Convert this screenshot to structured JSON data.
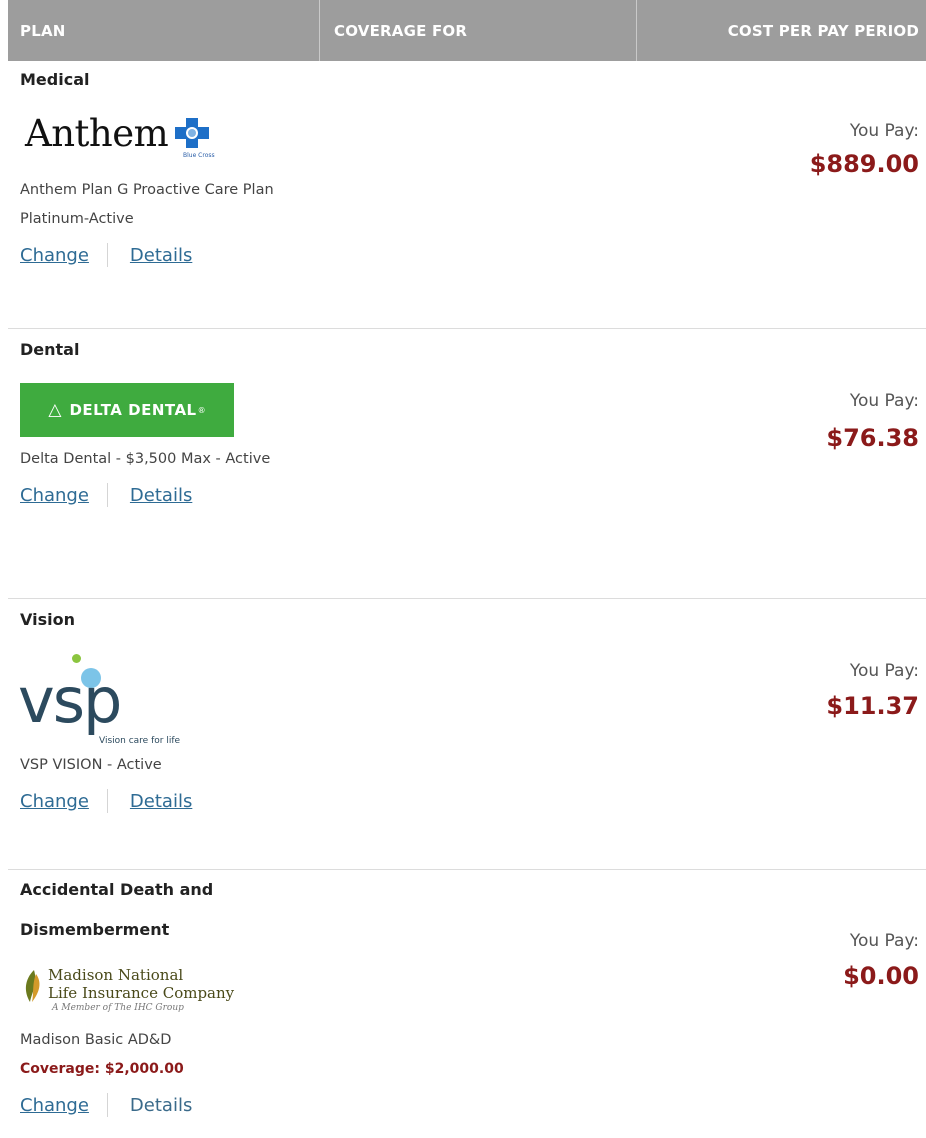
{
  "header": {
    "col_plan": "PLAN",
    "col_coverage": "COVERAGE FOR",
    "col_cost": "COST PER PAY PERIOD"
  },
  "pay_label": "You Pay:",
  "links": {
    "change": "Change",
    "details": "Details"
  },
  "plans": [
    {
      "category": "Medical",
      "logo": {
        "name": "Anthem",
        "sub": "Blue Cross",
        "icon": "anthem-cross-shield"
      },
      "description_lines": [
        "Anthem Plan G Proactive Care Plan",
        "Platinum-Active"
      ],
      "cost": "$889.00"
    },
    {
      "category": "Dental",
      "logo": {
        "name": "DELTA DENTAL",
        "mark": "®",
        "color": "#3fab3f"
      },
      "description_lines": [
        "Delta Dental - $3,500 Max - Active"
      ],
      "cost": "$76.38"
    },
    {
      "category": "Vision",
      "logo": {
        "name": "vsp",
        "tagline": "Vision care for life"
      },
      "description_lines": [
        "VSP VISION - Active"
      ],
      "cost": "$11.37"
    },
    {
      "category_lines": [
        "Accidental Death and",
        "Dismemberment"
      ],
      "logo": {
        "line1": "Madison National",
        "line2": "Life Insurance Company",
        "line3": "A Member of The IHC Group"
      },
      "description_lines": [
        "Madison Basic AD&D"
      ],
      "coverage": "Coverage: $2,000.00",
      "cost": "$0.00"
    }
  ],
  "colors": {
    "header_bg": "#9d9d9d",
    "price": "#8b1a1a",
    "link": "#2e6b94"
  }
}
